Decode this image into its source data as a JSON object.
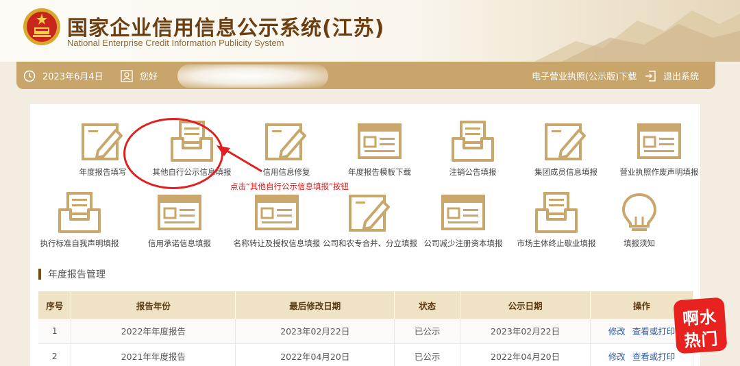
{
  "header": {
    "title": "国家企业信用信息公示系统(江苏)",
    "subtitle": "National Enterprise Credit Information Publicity System"
  },
  "statusbar": {
    "date": "2023年6月4日",
    "greeting": "您好",
    "license_download": "电子营业执照(公示版)下载",
    "logout": "退出系统"
  },
  "tiles": [
    {
      "label": "年度报告填写",
      "icon": "edit-form-icon"
    },
    {
      "label": "其他自行公示信息填报",
      "icon": "inbox-tray-icon"
    },
    {
      "label": "信用信息修复",
      "icon": "edit-form-icon"
    },
    {
      "label": "年度报告模板下载",
      "icon": "window-list-icon"
    },
    {
      "label": "注销公告填报",
      "icon": "inbox-tray-icon"
    },
    {
      "label": "集团成员信息填报",
      "icon": "edit-form-icon"
    },
    {
      "label": "营业执照作废声明填报",
      "icon": "window-list-icon"
    },
    {
      "label": "执行标准自我声明填报",
      "icon": "inbox-tray-icon"
    },
    {
      "label": "信用承诺信息填报",
      "icon": "window-list-icon"
    },
    {
      "label": "名称转让及授权信息填报",
      "icon": "window-list-icon"
    },
    {
      "label": "公司和农专合并、分立填报",
      "icon": "edit-form-icon"
    },
    {
      "label": "公司减少注册资本填报",
      "icon": "window-list-icon"
    },
    {
      "label": "市场主体终止歇业填报",
      "icon": "inbox-tray-icon"
    },
    {
      "label": "填报须知",
      "icon": "lightbulb-icon"
    }
  ],
  "annotation": {
    "text": "点击“其他自行公示信息填报”按钮"
  },
  "section": {
    "title": "年度报告管理"
  },
  "table": {
    "headers": [
      "序号",
      "报告年份",
      "最后修改日期",
      "状态",
      "公示日期",
      "操作"
    ],
    "rows": [
      {
        "no": "1",
        "year": "2022年年度报告",
        "modified": "2023年02月22日",
        "status": "已公示",
        "published": "2023年02月22日",
        "edit": "修改",
        "view": "查看或打印"
      },
      {
        "no": "2",
        "year": "2021年年度报告",
        "modified": "2022年04月20日",
        "status": "已公示",
        "published": "2022年04月20日",
        "edit": "修改",
        "view": "查看或打印"
      }
    ]
  },
  "watermark": {
    "line1": "啊水",
    "line2": "热门"
  },
  "colors": {
    "brand_brown": "#6b3f12",
    "bar_gold": "#c8a56a",
    "icon_gold": "#c9a66b",
    "link_blue": "#2d5da8",
    "annotation_red": "#e02020"
  }
}
